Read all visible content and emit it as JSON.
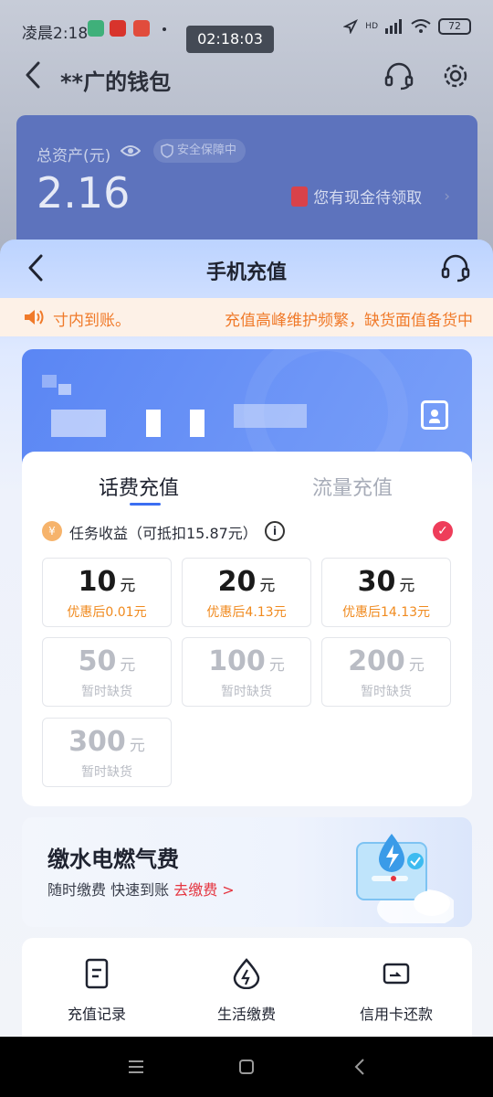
{
  "status_bar": {
    "time": "凌晨2:18",
    "clock_overlay": "02:18:03",
    "network": "HD",
    "battery": "72"
  },
  "wallet": {
    "title": "**广的钱包",
    "asset_label": "总资产(元)",
    "secure_badge": "安全保障中",
    "asset_value": "2.16",
    "cash_notice": "您有现金待领取"
  },
  "sheet": {
    "title": "手机充值",
    "notice_left": "寸内到账。",
    "notice_right": "充值高峰维护频繁，缺货面值备货中",
    "tabs": [
      {
        "label": "话费充值",
        "active": true
      },
      {
        "label": "流量充值",
        "active": false
      }
    ],
    "task": {
      "coin_symbol": "¥",
      "text": "任务收益（可抵扣15.87元）",
      "info_symbol": "i",
      "checked": true
    },
    "tiles": [
      {
        "amount": "10",
        "unit": "元",
        "sub": "优惠后0.01元",
        "available": true
      },
      {
        "amount": "20",
        "unit": "元",
        "sub": "优惠后4.13元",
        "available": true
      },
      {
        "amount": "30",
        "unit": "元",
        "sub": "优惠后14.13元",
        "available": true
      },
      {
        "amount": "50",
        "unit": "元",
        "sub": "暂时缺货",
        "available": false
      },
      {
        "amount": "100",
        "unit": "元",
        "sub": "暂时缺货",
        "available": false
      },
      {
        "amount": "200",
        "unit": "元",
        "sub": "暂时缺货",
        "available": false
      },
      {
        "amount": "300",
        "unit": "元",
        "sub": "暂时缺货",
        "available": false
      }
    ],
    "utility": {
      "title": "缴水电燃气费",
      "subtitle": "随时缴费 快速到账",
      "link": "去缴费 >"
    },
    "quick_actions": [
      {
        "label": "充值记录",
        "icon": "document-icon"
      },
      {
        "label": "生活缴费",
        "icon": "lightning-icon"
      },
      {
        "label": "信用卡还款",
        "icon": "credit-card-icon"
      }
    ]
  },
  "colors": {
    "accent_blue": "#3b6ef2",
    "discount_orange": "#f08a1e",
    "notice_orange": "#f07a2a",
    "check_red": "#ee3d5a"
  }
}
